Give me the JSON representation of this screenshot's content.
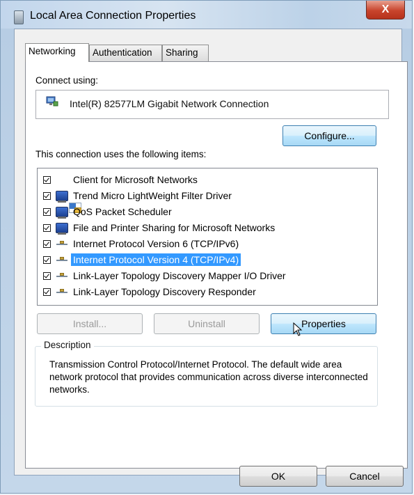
{
  "window": {
    "title": "Local Area Connection Properties",
    "close_label": "X"
  },
  "tabs": [
    {
      "label": "Networking",
      "active": true
    },
    {
      "label": "Authentication",
      "active": false
    },
    {
      "label": "Sharing",
      "active": false
    }
  ],
  "connect_using": {
    "label": "Connect using:",
    "adapter": "Intel(R) 82577LM Gigabit Network Connection",
    "configure_label": "Configure..."
  },
  "items": {
    "label": "This connection uses the following items:",
    "list": [
      {
        "label": "Client for Microsoft Networks",
        "checked": true,
        "icon": "client-icon"
      },
      {
        "label": "Trend Micro LightWeight Filter Driver",
        "checked": true,
        "icon": "network-service-icon"
      },
      {
        "label": "QoS Packet Scheduler",
        "checked": true,
        "icon": "network-service-icon"
      },
      {
        "label": "File and Printer Sharing for Microsoft Networks",
        "checked": true,
        "icon": "network-service-icon"
      },
      {
        "label": "Internet Protocol Version 6 (TCP/IPv6)",
        "checked": true,
        "icon": "protocol-icon"
      },
      {
        "label": "Internet Protocol Version 4 (TCP/IPv4)",
        "checked": true,
        "icon": "protocol-icon",
        "selected": true
      },
      {
        "label": "Link-Layer Topology Discovery Mapper I/O Driver",
        "checked": true,
        "icon": "protocol-icon"
      },
      {
        "label": "Link-Layer Topology Discovery Responder",
        "checked": true,
        "icon": "protocol-icon"
      }
    ]
  },
  "buttons": {
    "install": "Install...",
    "uninstall": "Uninstall",
    "properties": "Properties",
    "ok": "OK",
    "cancel": "Cancel"
  },
  "description": {
    "title": "Description",
    "text": "Transmission Control Protocol/Internet Protocol. The default wide area network protocol that provides communication across diverse interconnected networks."
  }
}
